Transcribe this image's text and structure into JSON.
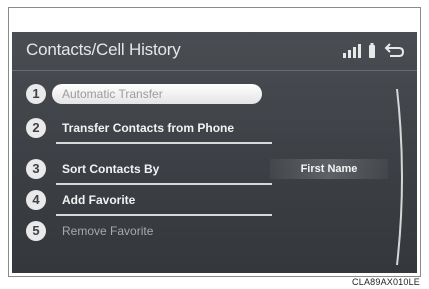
{
  "header": {
    "title": "Contacts/Cell History"
  },
  "icons": {
    "signal": "signal-bars-icon",
    "battery": "battery-icon",
    "back": "back-arrow-icon"
  },
  "menu": {
    "items": [
      {
        "number": "1",
        "label": "Automatic Transfer",
        "state": "selected"
      },
      {
        "number": "2",
        "label": "Transfer Contacts from Phone",
        "state": "normal"
      },
      {
        "number": "3",
        "label": "Sort Contacts By",
        "state": "normal"
      },
      {
        "number": "4",
        "label": "Add Favorite",
        "state": "normal"
      },
      {
        "number": "5",
        "label": "Remove Favorite",
        "state": "disabled"
      }
    ],
    "sort_value": "First Name"
  },
  "caption": "CLA89AX010LE",
  "colors": {
    "screen_bg": "#3c4045",
    "text": "#f2f2f2",
    "selected_bg": "#ffffff"
  }
}
